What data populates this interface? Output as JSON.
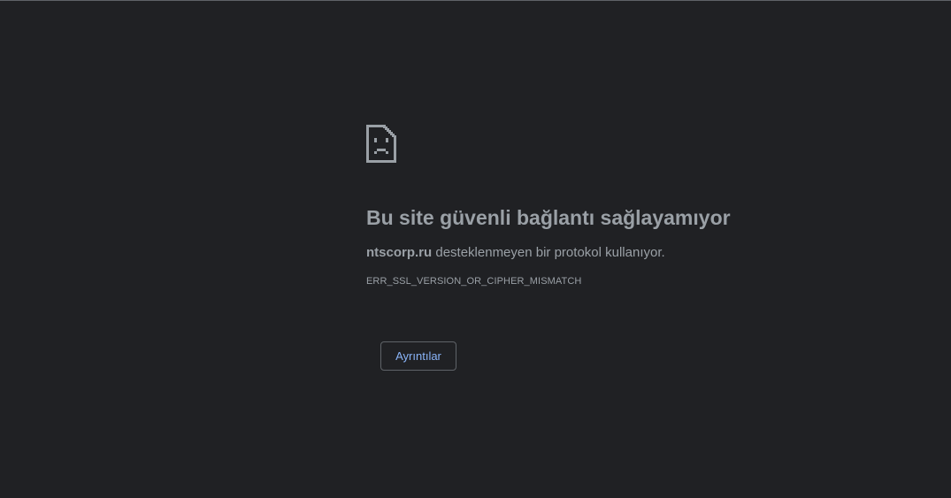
{
  "error_page": {
    "icon": "sad-page-icon",
    "title": "Bu site güvenli bağlantı sağlayamıyor",
    "host": "ntscorp.ru",
    "description_suffix": " desteklenmeyen bir protokol kullanıyor.",
    "error_code": "ERR_SSL_VERSION_OR_CIPHER_MISMATCH",
    "details_button_label": "Ayrıntılar"
  },
  "colors": {
    "background": "#202124",
    "text": "#9aa0a6",
    "link": "#8ab4f8",
    "border": "#5f6368"
  }
}
